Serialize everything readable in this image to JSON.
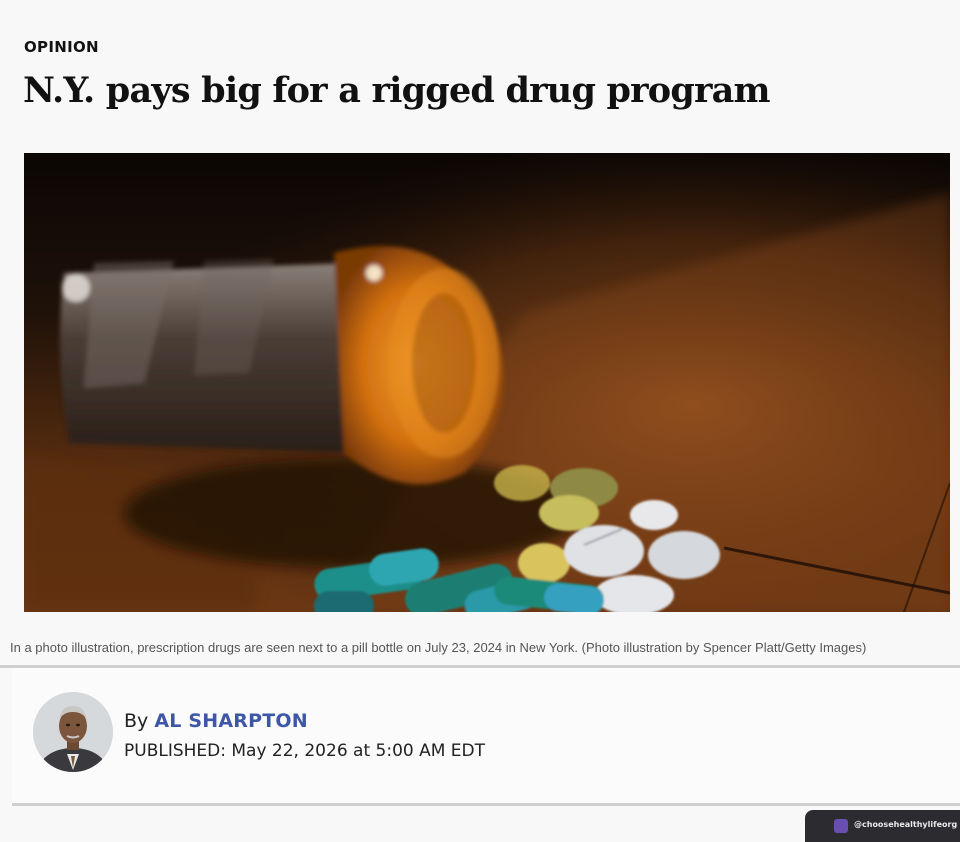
{
  "article": {
    "section": "OPINION",
    "headline": "N.Y. pays big for a rigged drug program",
    "image_caption": "In a photo illustration, prescription drugs are seen next to a pill bottle on July 23, 2024 in New York. (Photo illustration by Spencer Platt/Getty Images)"
  },
  "byline": {
    "prefix": "By",
    "author": "AL SHARPTON",
    "published": "PUBLISHED: May 22, 2026 at 5:00 AM EDT"
  },
  "watermark": {
    "handle": "@choosehealthylifeorg"
  },
  "colors": {
    "author_link": "#3d56a8",
    "divider": "#cfcfd2",
    "pill_bottle": "#d2700f",
    "capsule_teal": "#1f8f8a"
  }
}
